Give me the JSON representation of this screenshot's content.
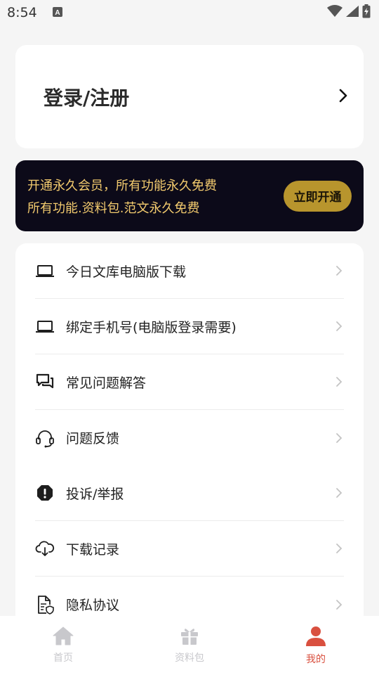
{
  "status_bar": {
    "time": "8:54"
  },
  "login": {
    "title": "登录/注册"
  },
  "vip": {
    "line1": "开通永久会员，所有功能永久免费",
    "line2": "所有功能.资料包.范文永久免费",
    "button": "立即开通"
  },
  "menu": {
    "items": [
      {
        "label": "今日文库电脑版下载",
        "icon": "laptop-icon"
      },
      {
        "label": "绑定手机号(电脑版登录需要)",
        "icon": "laptop-icon"
      },
      {
        "label": "常见问题解答",
        "icon": "chat-bubbles-icon"
      },
      {
        "label": "问题反馈",
        "icon": "headset-icon"
      },
      {
        "label": "投诉/举报",
        "icon": "alert-octagon-icon"
      },
      {
        "label": "下载记录",
        "icon": "cloud-download-icon"
      },
      {
        "label": "隐私协议",
        "icon": "privacy-document-icon"
      }
    ]
  },
  "nav": {
    "tabs": [
      {
        "label": "首页",
        "icon": "home-icon"
      },
      {
        "label": "资料包",
        "icon": "gift-icon"
      },
      {
        "label": "我的",
        "icon": "person-icon",
        "active": true
      }
    ],
    "active_color": "#d9503f",
    "inactive_color": "#c8c8cc"
  },
  "colors": {
    "vip_background": "#0c0a19",
    "vip_text": "#f3cb6e",
    "vip_button": "#b8952d"
  }
}
